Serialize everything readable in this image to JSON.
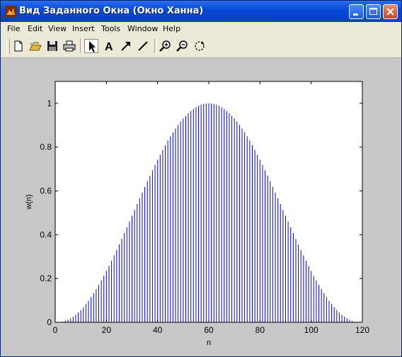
{
  "window": {
    "title": "Вид Заданного Окна (Окно Ханна)"
  },
  "menu": [
    "File",
    "Edit",
    "View",
    "Insert",
    "Tools",
    "Window",
    "Help"
  ],
  "toolbar": [
    {
      "name": "new-figure-button",
      "icon": "new-file-icon"
    },
    {
      "name": "open-button",
      "icon": "open-folder-icon"
    },
    {
      "name": "save-button",
      "icon": "floppy-disk-icon"
    },
    {
      "name": "print-button",
      "icon": "printer-icon"
    },
    {
      "name": "edit-plot-button",
      "icon": "arrow-cursor-icon",
      "active": true
    },
    {
      "name": "insert-text-button",
      "icon": "text-a-icon"
    },
    {
      "name": "insert-arrow-button",
      "icon": "arrow-icon"
    },
    {
      "name": "insert-line-button",
      "icon": "line-icon"
    },
    {
      "name": "zoom-in-button",
      "icon": "zoom-in-icon"
    },
    {
      "name": "zoom-out-button",
      "icon": "zoom-out-icon"
    },
    {
      "name": "rotate-button",
      "icon": "rotate-3d-icon"
    }
  ],
  "chart_data": {
    "type": "stem",
    "xlabel": "n",
    "ylabel": "w(n)",
    "xlim": [
      0,
      120
    ],
    "ylim": [
      0,
      1.1
    ],
    "xticks": [
      0,
      20,
      40,
      60,
      80,
      100,
      120
    ],
    "yticks": [
      0,
      0.2,
      0.4,
      0.6,
      0.8,
      1
    ],
    "ytick_labels": [
      "0",
      "0.2",
      "0.4",
      "0.6",
      "0.8",
      "1"
    ],
    "grid": false,
    "line_color": "#0000ff",
    "series": [
      {
        "n": [
          1,
          119
        ],
        "formula": "w(n) = 0.5*(1 - cos(2*pi*(n-1)/118))"
      }
    ]
  }
}
